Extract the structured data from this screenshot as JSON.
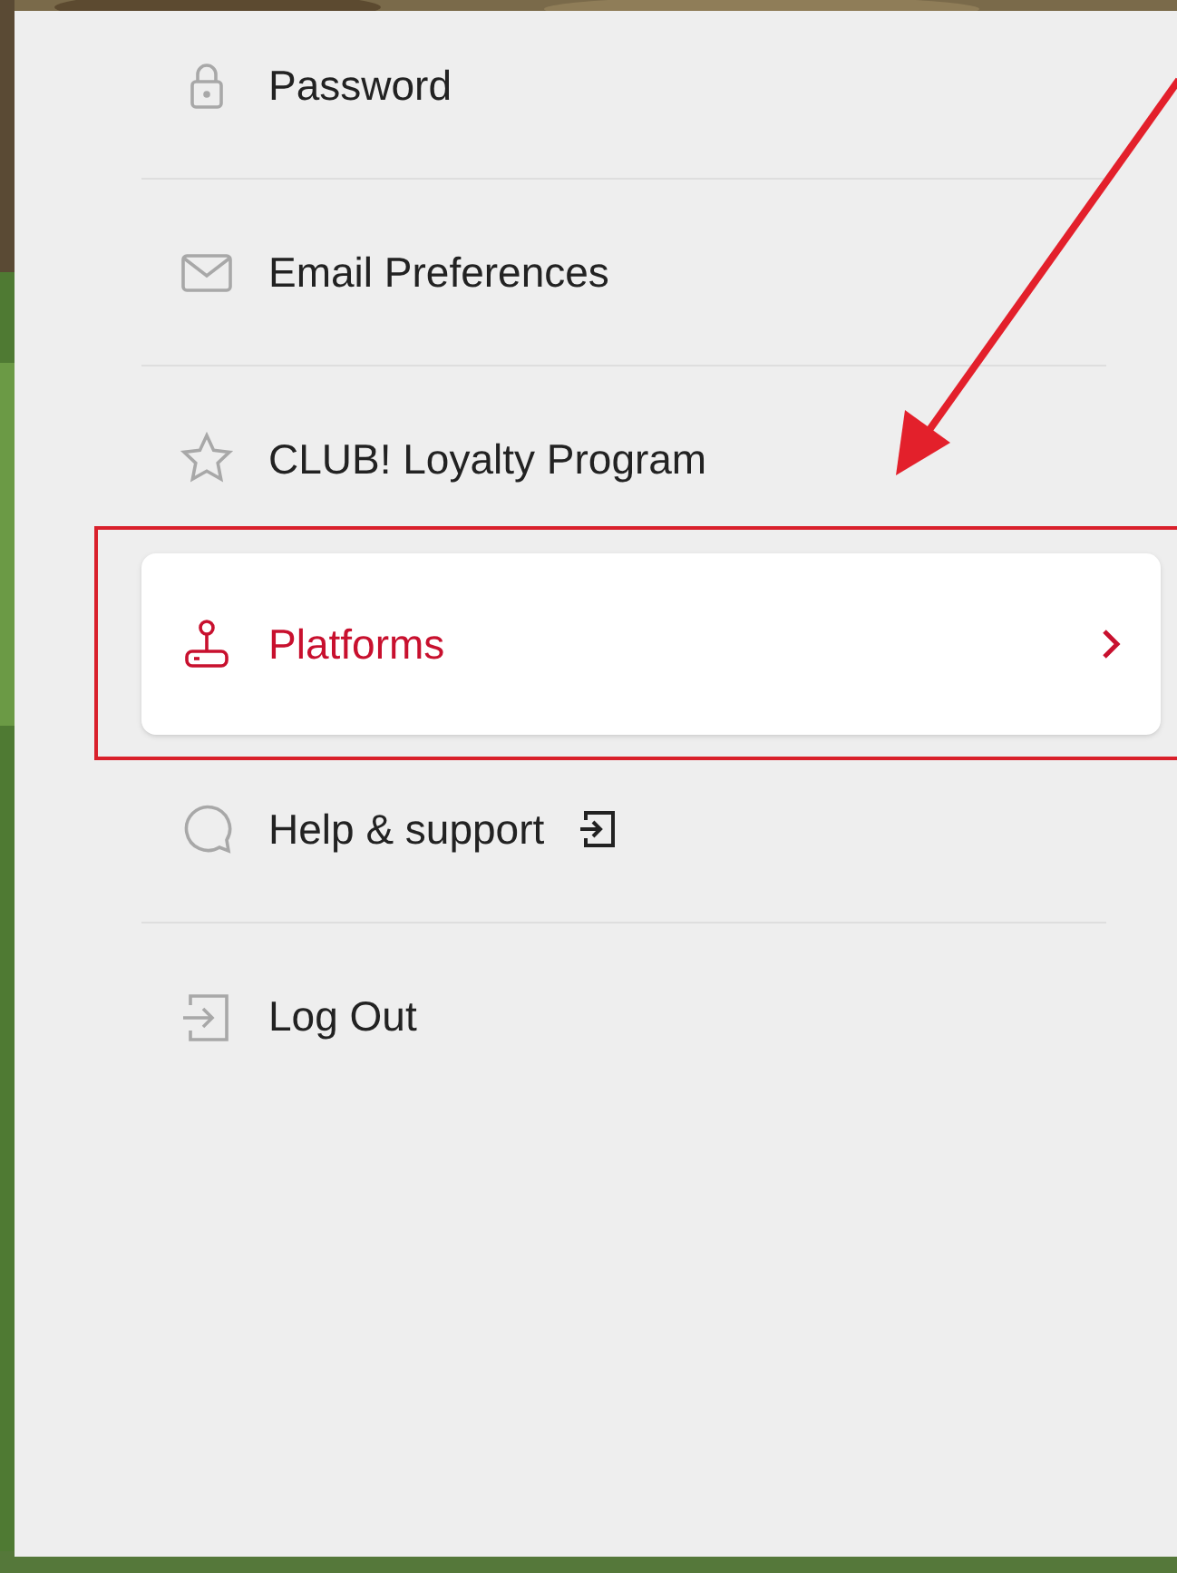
{
  "menu": {
    "items": [
      {
        "kind": "password",
        "label": "Password",
        "selected": false,
        "external": false
      },
      {
        "kind": "email",
        "label": "Email Preferences",
        "selected": false,
        "external": false
      },
      {
        "kind": "loyalty",
        "label": "CLUB! Loyalty Program",
        "selected": false,
        "external": false
      },
      {
        "kind": "platforms",
        "label": "Platforms",
        "selected": true,
        "external": false
      },
      {
        "kind": "help",
        "label": "Help & support",
        "selected": false,
        "external": true
      },
      {
        "kind": "logout",
        "label": "Log Out",
        "selected": false,
        "external": false
      }
    ]
  },
  "annotations": {
    "arrow": true,
    "highlight_box": true
  }
}
